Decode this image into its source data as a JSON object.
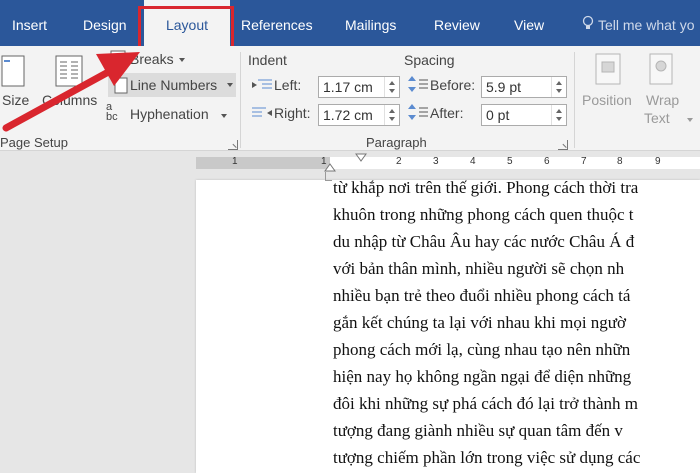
{
  "tabs": [
    {
      "label": "Insert"
    },
    {
      "label": "Design"
    },
    {
      "label": "Layout"
    },
    {
      "label": "References"
    },
    {
      "label": "Mailings"
    },
    {
      "label": "Review"
    },
    {
      "label": "View"
    }
  ],
  "tell_me": "Tell me what yo",
  "page_setup": {
    "size_label": "Size",
    "columns_label": "Columns",
    "breaks_label": "Breaks",
    "line_numbers_label": "Line Numbers",
    "hyphenation_label": "Hyphenation",
    "group_label": "Page Setup"
  },
  "paragraph": {
    "indent_title": "Indent",
    "spacing_title": "Spacing",
    "left_label": "Left:",
    "left_value": "1.17 cm",
    "right_label": "Right:",
    "right_value": "1.72 cm",
    "before_label": "Before:",
    "before_value": "5.9 pt",
    "after_label": "After:",
    "after_value": "0 pt",
    "group_label": "Paragraph"
  },
  "arrange": {
    "position_label": "Position",
    "wrap_label": "Wrap",
    "wrap_label2": "Text"
  },
  "ruler": [
    "1",
    "1",
    "2",
    "3",
    "4",
    "5",
    "6",
    "7",
    "8",
    "9"
  ],
  "document_lines": [
    "từ khắp nơi trên thế giới. Phong cách thời tra",
    "khuôn trong những phong cách quen thuộc t",
    "du nhập từ Châu Âu hay các nước Châu Á đ",
    "với bản thân mình, nhiều người sẽ chọn nh",
    "nhiều bạn trẻ theo đuổi nhiều phong cách tá",
    "gắn kết chúng ta lại với nhau khi mọi ngườ",
    "phong cách mới lạ, cùng nhau tạo nên nhữn",
    "hiện nay họ không ngần ngại để diện những",
    "đôi khi những sự phá cách đó lại trở thành m",
    "tượng đang giành nhiều sự quan tâm đến v",
    "tượng chiếm phần lớn trong việc sử dụng các"
  ],
  "colors": {
    "brand": "#2b579a",
    "highlight": "#d9262e"
  }
}
